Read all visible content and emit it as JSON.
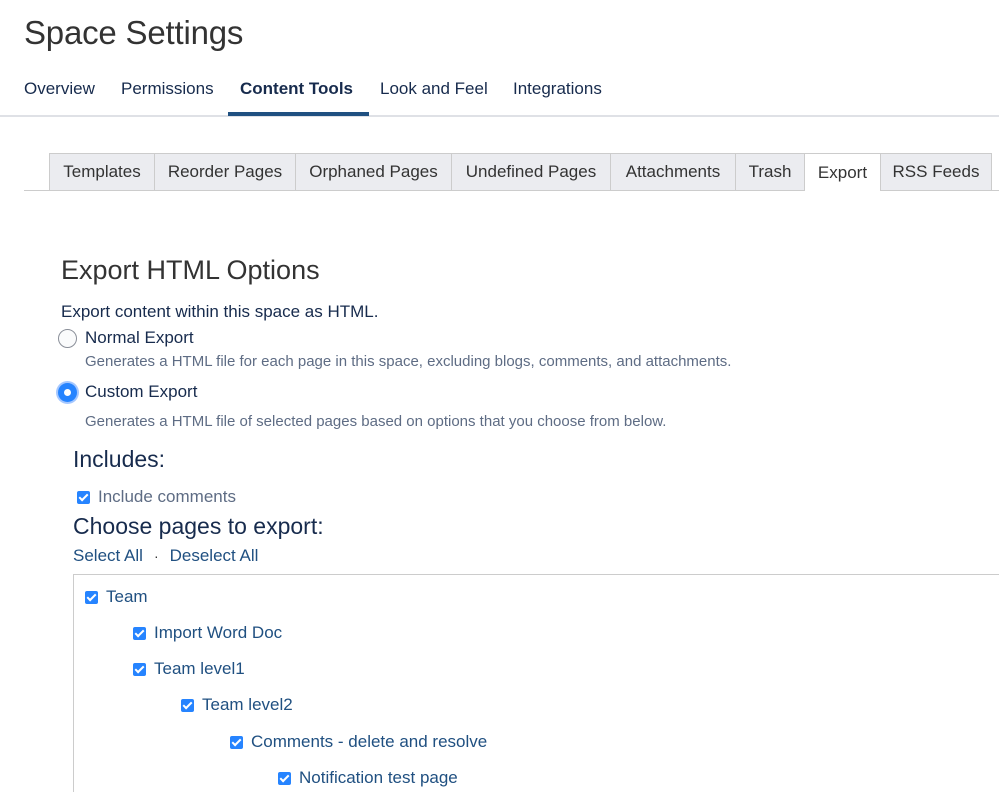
{
  "page": {
    "title": "Space Settings"
  },
  "top_nav": {
    "items": [
      {
        "label": "Overview"
      },
      {
        "label": "Permissions"
      },
      {
        "label": "Content Tools"
      },
      {
        "label": "Look and Feel"
      },
      {
        "label": "Integrations"
      }
    ],
    "active": "Content Tools"
  },
  "tabs": {
    "items": [
      {
        "label": "Templates"
      },
      {
        "label": "Reorder Pages"
      },
      {
        "label": "Orphaned Pages"
      },
      {
        "label": "Undefined Pages"
      },
      {
        "label": "Attachments"
      },
      {
        "label": "Trash"
      },
      {
        "label": "Export"
      },
      {
        "label": "RSS Feeds"
      }
    ],
    "active": "Export"
  },
  "export": {
    "title": "Export HTML Options",
    "description": "Export content within this space as HTML.",
    "options": [
      {
        "label": "Normal Export",
        "help": "Generates a HTML file for each page in this space, excluding blogs, comments, and attachments.",
        "selected": false
      },
      {
        "label": "Custom Export",
        "help": "Generates a HTML file of selected pages based on options that you choose from below.",
        "selected": true
      }
    ]
  },
  "includes": {
    "title": "Includes:",
    "include_comments": {
      "label": "Include comments",
      "checked": true
    }
  },
  "choose": {
    "title": "Choose pages to export:",
    "select_all": "Select All",
    "separator": "·",
    "deselect_all": "Deselect All"
  },
  "pages": [
    {
      "label": "Team",
      "level": 0,
      "checked": true
    },
    {
      "label": "Import Word Doc",
      "level": 1,
      "checked": true
    },
    {
      "label": "Team level1",
      "level": 1,
      "checked": true
    },
    {
      "label": "Team level2",
      "level": 2,
      "checked": true
    },
    {
      "label": "Comments - delete and resolve",
      "level": 3,
      "checked": true
    },
    {
      "label": "Notification test page",
      "level": 4,
      "checked": true
    }
  ],
  "colors": {
    "link": "#205081",
    "checkbox": "#2684ff",
    "nav_underline": "#205081",
    "tab_inactive": "#ebecf0"
  }
}
